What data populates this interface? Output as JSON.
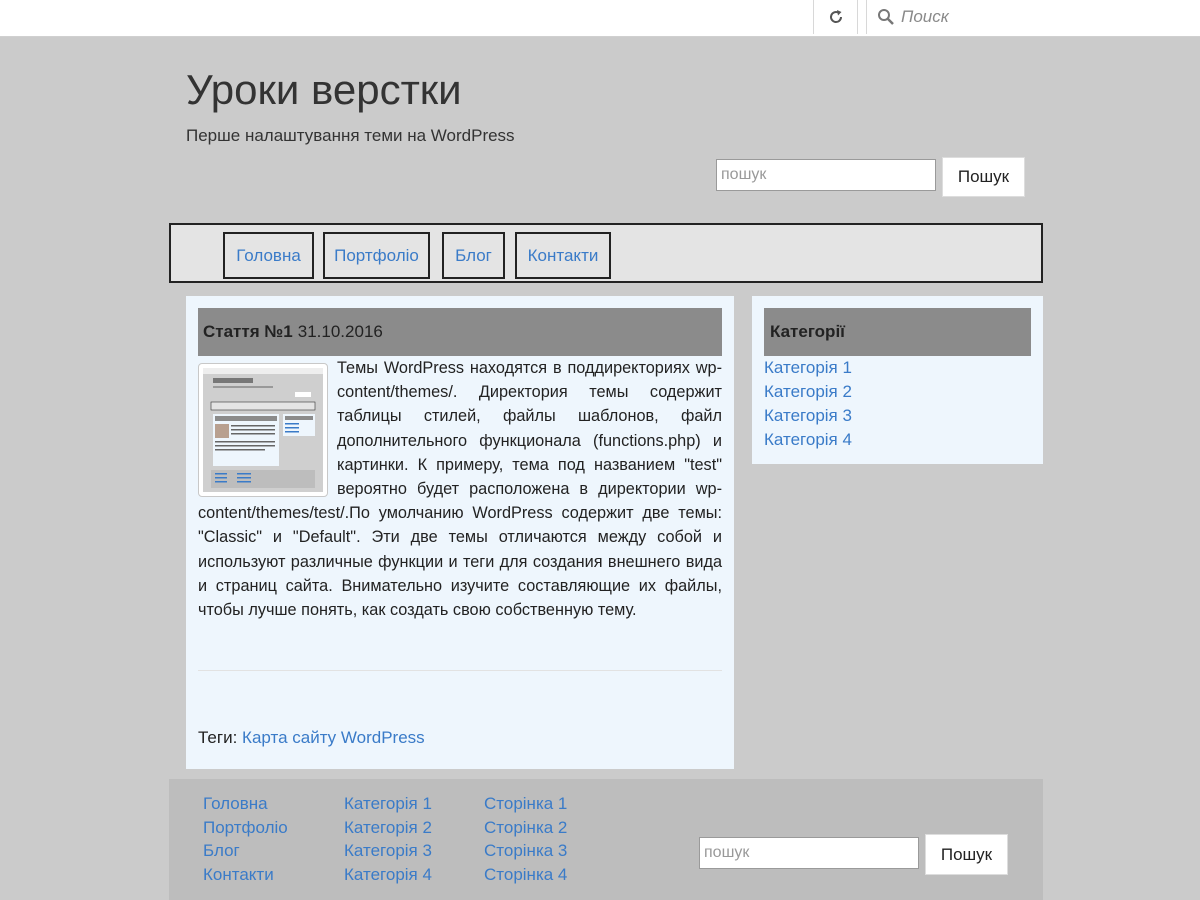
{
  "browser": {
    "search_placeholder": "Поиск"
  },
  "header": {
    "title": "Уроки верстки",
    "description": "Перше налаштування теми на WordPress",
    "search_placeholder": "пошук",
    "search_button": "Пошук"
  },
  "nav": {
    "items": [
      {
        "label": "Головна"
      },
      {
        "label": "Портфоліо"
      },
      {
        "label": "Блог"
      },
      {
        "label": "Контакти"
      }
    ]
  },
  "article": {
    "title": "Стаття №1",
    "date": "31.10.2016",
    "body": "Темы WordPress находятся в поддиректориях wp-content/themes/. Директория темы содержит таблицы стилей, файлы шаблонов, файл дополнительного функционала (functions.php) и картинки. К примеру, тема под названием \"test\" вероятно будет расположена в директории wp-content/themes/test/.По умолчанию WordPress содержит две темы: \"Classic\" и \"Default\". Эти две темы отличаются между собой и используют различные функции и теги для создания внешнего вида и страниц сайта. Внимательно изучите составляющие их файлы, чтобы лучше понять, как создать свою собственную тему.",
    "tags_label": "Теги:",
    "tag": "Карта сайту WordPress"
  },
  "sidebar": {
    "title": "Категорії",
    "items": [
      "Категорія 1",
      "Категорія 2",
      "Категорія 3",
      "Категорія 4"
    ]
  },
  "footer": {
    "col1": [
      "Головна",
      "Портфоліо",
      "Блог",
      "Контакти"
    ],
    "col2": [
      "Категорія 1",
      "Категорія 2",
      "Категорія 3",
      "Категорія 4"
    ],
    "col3": [
      "Сторінка 1",
      "Сторінка 2",
      "Сторінка 3",
      "Сторінка 4"
    ],
    "search_placeholder": "пошук",
    "search_button": "Пошук"
  },
  "colors": {
    "page_bg": "#cbcbcb",
    "link": "#3a7bc8",
    "panel_bg": "#eef6fd",
    "header_bar": "#8b8b8b"
  }
}
